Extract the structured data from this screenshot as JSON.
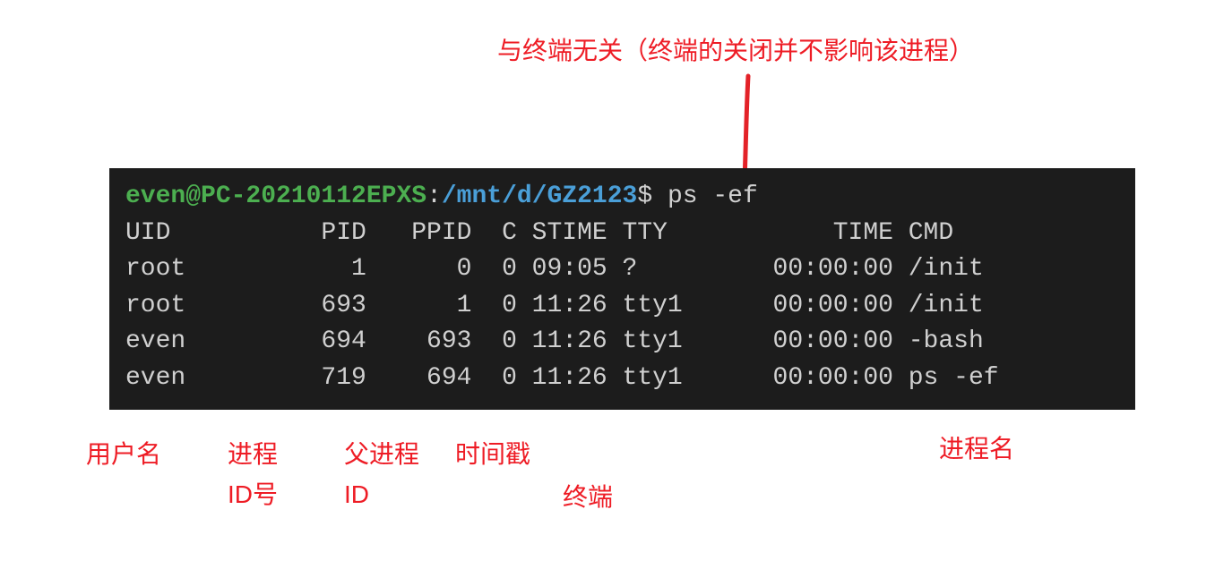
{
  "top_annotation": "与终端无关（终端的关闭并不影响该进程）",
  "prompt": {
    "user_host": "even@PC-20210112EPXS",
    "path": "/mnt/d/GZ2123",
    "symbol": "$",
    "command": "ps -ef"
  },
  "header": {
    "uid": "UID",
    "pid": "PID",
    "ppid": "PPID",
    "c": "C",
    "stime": "STIME",
    "tty": "TTY",
    "time": "TIME",
    "cmd": "CMD"
  },
  "rows": [
    {
      "uid": "root",
      "pid": "1",
      "ppid": "0",
      "c": "0",
      "stime": "09:05",
      "tty": "?",
      "time": "00:00:00",
      "cmd": "/init"
    },
    {
      "uid": "root",
      "pid": "693",
      "ppid": "1",
      "c": "0",
      "stime": "11:26",
      "tty": "tty1",
      "time": "00:00:00",
      "cmd": "/init"
    },
    {
      "uid": "even",
      "pid": "694",
      "ppid": "693",
      "c": "0",
      "stime": "11:26",
      "tty": "tty1",
      "time": "00:00:00",
      "cmd": "-bash"
    },
    {
      "uid": "even",
      "pid": "719",
      "ppid": "694",
      "c": "0",
      "stime": "11:26",
      "tty": "tty1",
      "time": "00:00:00",
      "cmd": "ps -ef"
    }
  ],
  "bottom_labels": {
    "user": "用户名",
    "pid_line1": "进程",
    "pid_line2": "ID号",
    "ppid_line1": "父进程",
    "ppid_line2": "ID",
    "stime": "时间戳",
    "tty": "终端",
    "cmd": "进程名"
  }
}
